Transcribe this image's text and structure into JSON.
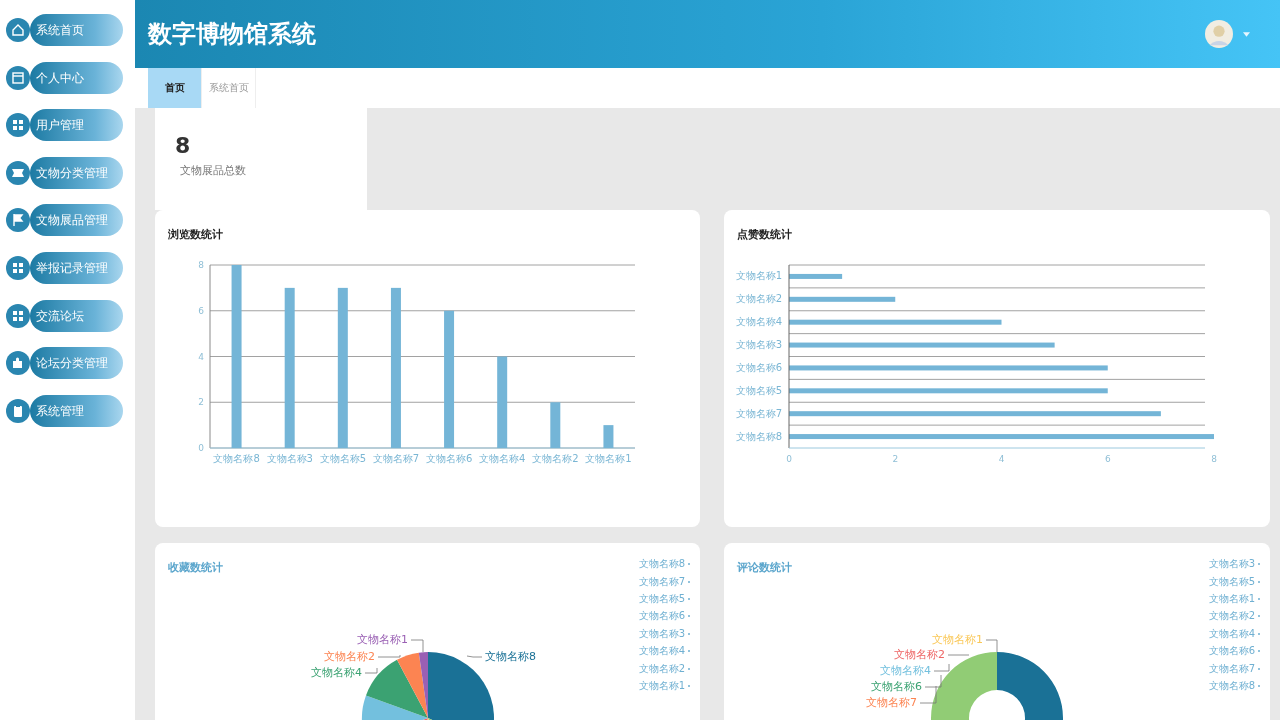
{
  "sidebar": {
    "items": [
      {
        "label": "系统首页"
      },
      {
        "label": "个人中心"
      },
      {
        "label": "用户管理"
      },
      {
        "label": "文物分类管理"
      },
      {
        "label": "文物展品管理"
      },
      {
        "label": "举报记录管理"
      },
      {
        "label": "交流论坛"
      },
      {
        "label": "论坛分类管理"
      },
      {
        "label": "系统管理"
      }
    ]
  },
  "header": {
    "title": "数字博物馆系统"
  },
  "tabs": [
    {
      "label": "首页",
      "selected": true
    },
    {
      "label": "系统首页",
      "selected": false
    }
  ],
  "stat_card": {
    "value": "8",
    "label": "文物展品总数"
  },
  "views_chart": {
    "title": "浏览数统计",
    "chart_data": {
      "type": "bar",
      "categories": [
        "文物名称8",
        "文物名称3",
        "文物名称5",
        "文物名称7",
        "文物名称6",
        "文物名称4",
        "文物名称2",
        "文物名称1"
      ],
      "values": [
        8,
        7,
        7,
        7,
        6,
        4,
        2,
        1
      ],
      "grid": true,
      "ylim": [
        0,
        8
      ],
      "yticks": [
        0,
        2,
        4,
        6,
        8
      ]
    }
  },
  "likes_chart": {
    "title": "点赞数统计",
    "chart_data": {
      "type": "bar",
      "orientation": "horizontal",
      "categories": [
        "文物名称1",
        "文物名称2",
        "文物名称4",
        "文物名称3",
        "文物名称6",
        "文物名称5",
        "文物名称7",
        "文物名称8"
      ],
      "values": [
        1,
        2,
        4,
        5,
        6,
        6,
        7,
        8
      ],
      "grid": true,
      "xlim": [
        0,
        8
      ],
      "xticks": [
        0,
        2,
        4,
        6,
        8
      ]
    }
  },
  "favorites_chart": {
    "title": "收藏数统计",
    "kind": "pie",
    "slice_labels": [
      {
        "label": "文物名称1",
        "color": "#9a60b4"
      },
      {
        "label": "文物名称2",
        "color": "#fc8452"
      },
      {
        "label": "文物名称4",
        "color": "#3ba272"
      },
      {
        "label": "文物名称8",
        "color": "#1a7196"
      }
    ],
    "legend": [
      "文物名称8",
      "文物名称7",
      "文物名称5",
      "文物名称6",
      "文物名称3",
      "文物名称4",
      "文物名称2",
      "文物名称1"
    ]
  },
  "comments_chart": {
    "title": "评论数统计",
    "kind": "donut",
    "slice_labels": [
      {
        "label": "文物名称1",
        "color": "#fac858"
      },
      {
        "label": "文物名称2",
        "color": "#ee6666"
      },
      {
        "label": "文物名称4",
        "color": "#73c0de"
      },
      {
        "label": "文物名称6",
        "color": "#3ba272"
      },
      {
        "label": "文物名称7",
        "color": "#fc8452"
      }
    ],
    "legend": [
      "文物名称3",
      "文物名称5",
      "文物名称1",
      "文物名称2",
      "文物名称4",
      "文物名称6",
      "文物名称7",
      "文物名称8"
    ]
  }
}
